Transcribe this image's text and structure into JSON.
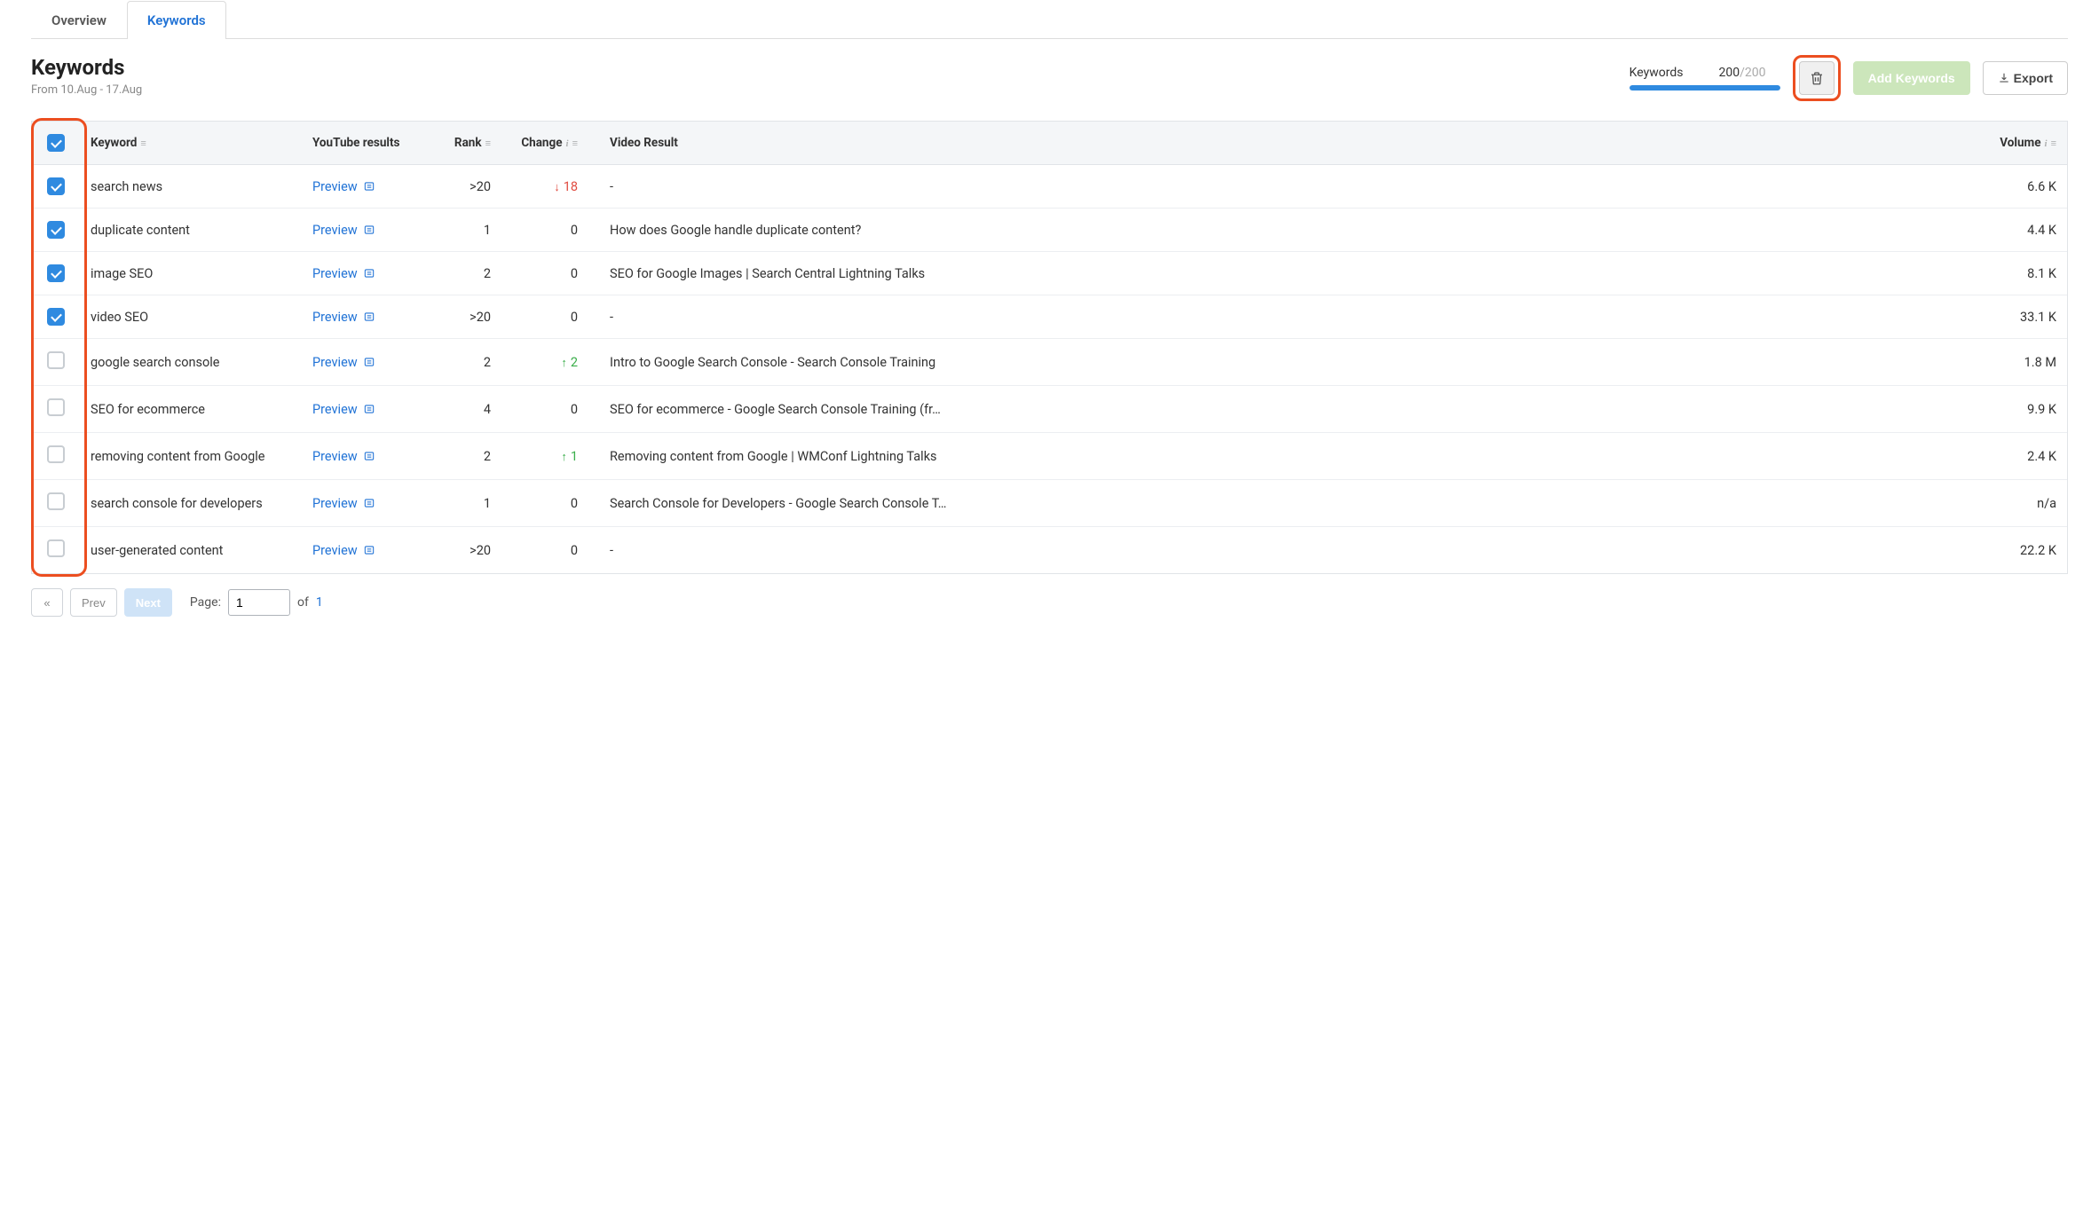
{
  "tabs": {
    "overview": "Overview",
    "keywords": "Keywords"
  },
  "page_title": "Keywords",
  "date_range": "From 10.Aug - 17.Aug",
  "quota": {
    "label": "Keywords",
    "used": "200",
    "total": "/200",
    "percent": 100
  },
  "add_keywords_label": "Add Keywords",
  "export_label": "Export",
  "columns": {
    "keyword": "Keyword",
    "youtube_results": "YouTube results",
    "rank": "Rank",
    "change": "Change",
    "video_result": "Video Result",
    "volume": "Volume"
  },
  "preview_label": "Preview",
  "rows": [
    {
      "checked": true,
      "keyword": "search news",
      "rank": ">20",
      "change_dir": "down",
      "change_val": "18",
      "video_result": "-",
      "volume": "6.6 K"
    },
    {
      "checked": true,
      "keyword": "duplicate content",
      "rank": "1",
      "change_dir": "none",
      "change_val": "0",
      "video_result": "How does Google handle duplicate content?",
      "volume": "4.4 K"
    },
    {
      "checked": true,
      "keyword": "image SEO",
      "rank": "2",
      "change_dir": "none",
      "change_val": "0",
      "video_result": "SEO for Google Images | Search Central Lightning Talks",
      "volume": "8.1 K"
    },
    {
      "checked": true,
      "keyword": "video SEO",
      "rank": ">20",
      "change_dir": "none",
      "change_val": "0",
      "video_result": "-",
      "volume": "33.1 K"
    },
    {
      "checked": false,
      "keyword": "google search console",
      "rank": "2",
      "change_dir": "up",
      "change_val": "2",
      "video_result": "Intro to Google Search Console - Search Console Training",
      "volume": "1.8 M"
    },
    {
      "checked": false,
      "keyword": "SEO for ecommerce",
      "rank": "4",
      "change_dir": "none",
      "change_val": "0",
      "video_result": "SEO for ecommerce - Google Search Console Training (fr…",
      "volume": "9.9 K"
    },
    {
      "checked": false,
      "keyword": "removing content from Google",
      "rank": "2",
      "change_dir": "up",
      "change_val": "1",
      "video_result": "Removing content from Google | WMConf Lightning Talks",
      "volume": "2.4 K"
    },
    {
      "checked": false,
      "keyword": "search console for developers",
      "rank": "1",
      "change_dir": "none",
      "change_val": "0",
      "video_result": "Search Console for Developers - Google Search Console T…",
      "volume": "n/a"
    },
    {
      "checked": false,
      "keyword": "user-generated content",
      "rank": ">20",
      "change_dir": "none",
      "change_val": "0",
      "video_result": "-",
      "volume": "22.2 K"
    }
  ],
  "pagination": {
    "prev": "Prev",
    "next": "Next",
    "page_label": "Page:",
    "page_value": "1",
    "of_label": "of",
    "total_pages": "1"
  }
}
